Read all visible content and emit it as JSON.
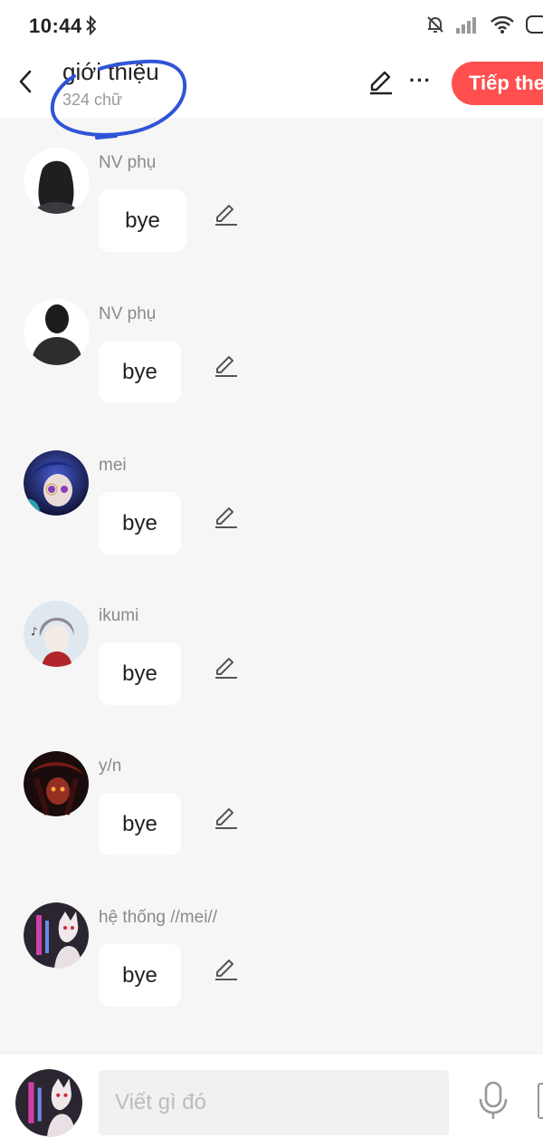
{
  "status_bar": {
    "time": "10:44"
  },
  "header": {
    "title": "giới thiệu",
    "subtitle": "324 chữ",
    "next_label": "Tiếp theo"
  },
  "messages": [
    {
      "name": "NV phụ",
      "text": "bye",
      "avatar": "silhouette-long-hair"
    },
    {
      "name": "NV phụ",
      "text": "bye",
      "avatar": "silhouette-short-hair"
    },
    {
      "name": "mei",
      "text": "bye",
      "avatar": "anime-dark-blue"
    },
    {
      "name": "ikumi",
      "text": "bye",
      "avatar": "anime-grey-hair"
    },
    {
      "name": "y/n",
      "text": "bye",
      "avatar": "anime-red-dark"
    },
    {
      "name": "hệ thống //mei//",
      "text": "bye",
      "avatar": "anime-neon-system"
    }
  ],
  "composer": {
    "placeholder": "Viết gì đó"
  },
  "colors": {
    "accent": "#ff4f4f",
    "annotation": "#2f54d8",
    "background": "#f6f6f6"
  }
}
